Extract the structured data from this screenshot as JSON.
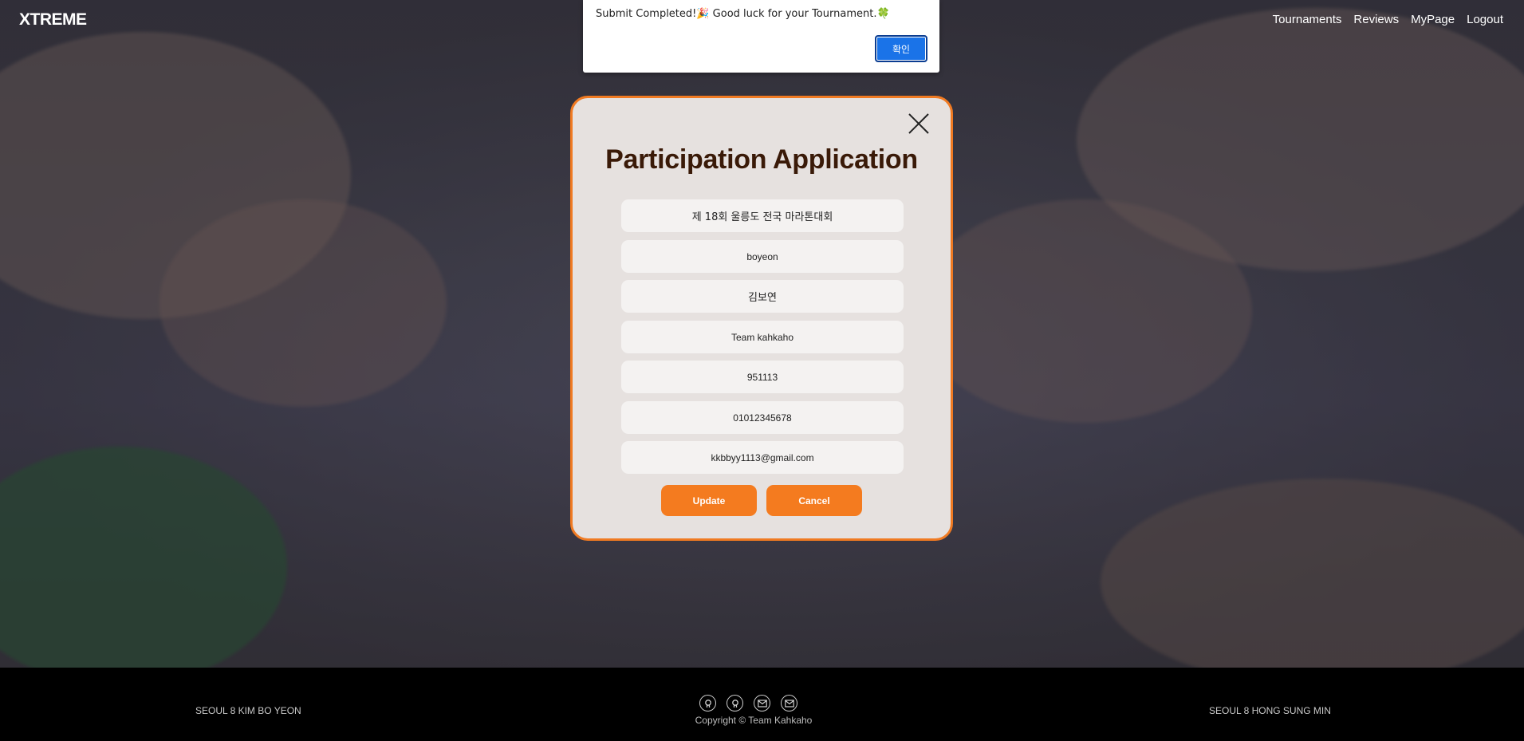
{
  "brand": "XTREME",
  "nav": [
    "Tournaments",
    "Reviews",
    "MyPage",
    "Logout"
  ],
  "alert": {
    "message": "Submit Completed!🎉 Good luck for your Tournament.🍀",
    "ok_label": "확인"
  },
  "modal": {
    "title": "Participation Application",
    "fields": {
      "tournament": "제 18회 울릉도 전국 마라톤대회",
      "user_id": "boyeon",
      "name": "김보연",
      "team": "Team kahkaho",
      "birth": "951113",
      "phone": "01012345678",
      "email": "kkbbyy1113@gmail.com"
    },
    "update_label": "Update",
    "cancel_label": "Cancel"
  },
  "footer": {
    "left": "SEOUL 8 KIM BO YEON",
    "right": "SEOUL 8 HONG SUNG MIN",
    "copyright": "Copyright © Team Kahkaho",
    "icons": [
      "github-icon",
      "github-icon",
      "mail-icon",
      "mail-icon"
    ]
  },
  "colors": {
    "accent": "#f47b1f",
    "title": "#3a1a08",
    "modal_bg": "#e6e1df",
    "alert_button": "#1a73e8"
  }
}
